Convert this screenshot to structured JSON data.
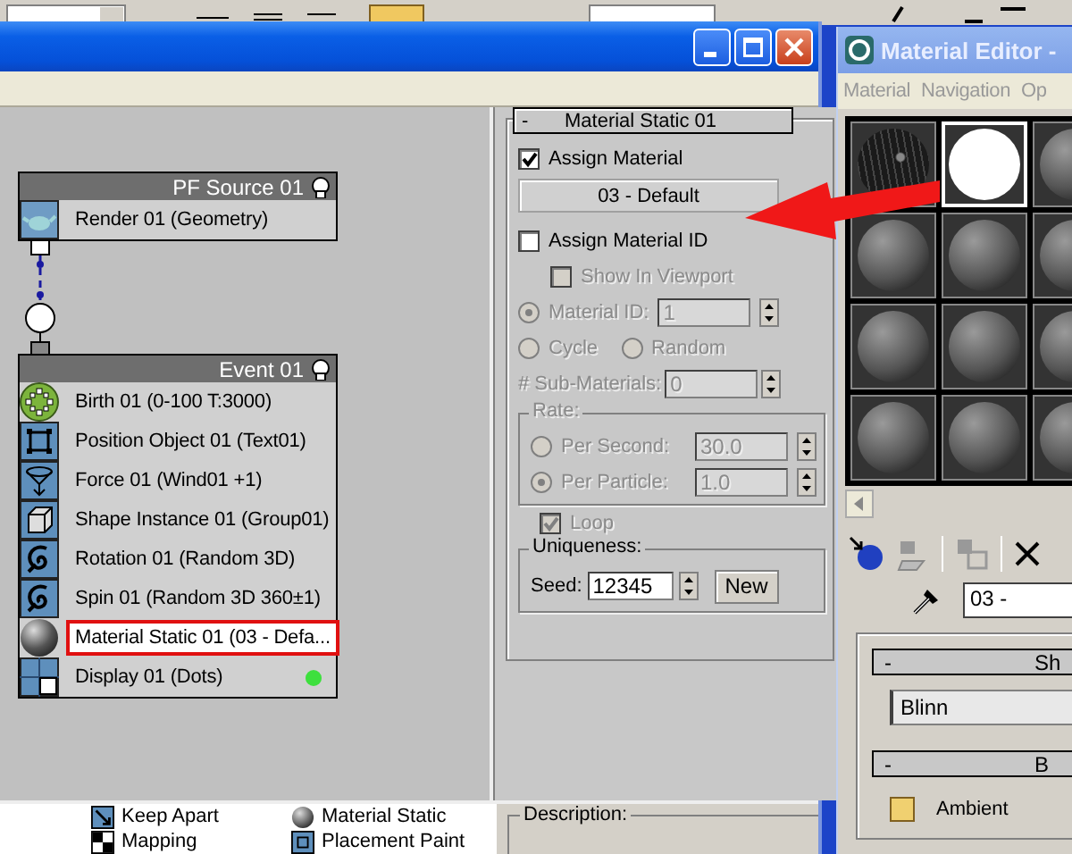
{
  "particle_view": {
    "nodes": [
      {
        "title": "PF Source 01",
        "operators": [
          {
            "kind": "render",
            "label": "Render 01 (Geometry)",
            "selected": false
          }
        ]
      },
      {
        "title": "Event 01",
        "operators": [
          {
            "kind": "birth",
            "label": "Birth 01 (0-100 T:3000)",
            "selected": false
          },
          {
            "kind": "position",
            "label": "Position Object 01 (Text01)",
            "selected": false
          },
          {
            "kind": "force",
            "label": "Force 01 (Wind01 +1)",
            "selected": false
          },
          {
            "kind": "shape",
            "label": "Shape Instance 01 (Group01)",
            "selected": false
          },
          {
            "kind": "rotation",
            "label": "Rotation 01 (Random 3D)",
            "selected": false
          },
          {
            "kind": "spin",
            "label": "Spin 01 (Random 3D 360±1)",
            "selected": false
          },
          {
            "kind": "material",
            "label": "Material Static 01 (03 - Defa...",
            "selected": true
          },
          {
            "kind": "display",
            "label": "Display 01 (Dots)",
            "selected": false
          }
        ]
      }
    ],
    "parameters": {
      "collapse": "-",
      "rollout_title": "Material Static 01",
      "assign_material": {
        "label": "Assign Material",
        "checked": true,
        "disabled": false
      },
      "material_button": "03 - Default",
      "assign_material_id": {
        "label": "Assign Material ID",
        "checked": false,
        "disabled": false
      },
      "show_in_viewport": {
        "label": "Show In Viewport",
        "checked": false,
        "disabled": true
      },
      "material_id": {
        "label": "Material ID:",
        "selected": true,
        "disabled": true,
        "value": "1"
      },
      "id_modes": [
        {
          "label": "Cycle",
          "selected": false,
          "disabled": true
        },
        {
          "label": "Random",
          "selected": false,
          "disabled": true
        }
      ],
      "sub_materials": {
        "label": "# Sub-Materials:",
        "value": "0",
        "disabled": true
      },
      "rate": {
        "title": "Rate:",
        "disabled": true,
        "options": [
          {
            "label": "Per Second:",
            "value": "30.0",
            "selected": false
          },
          {
            "label": "Per Particle:",
            "value": "1.0",
            "selected": true
          }
        ]
      },
      "loop": {
        "label": "Loop",
        "checked": true,
        "disabled": true
      },
      "uniqueness": {
        "title": "Uniqueness:",
        "seed_label": "Seed:",
        "seed": "12345",
        "new_button": "New"
      }
    },
    "depot": [
      {
        "kind": "keep_apart",
        "label": "Keep Apart"
      },
      {
        "kind": "material",
        "label": "Material Static"
      },
      {
        "kind": "mapping",
        "label": "Mapping"
      },
      {
        "kind": "placement",
        "label": "Placement Paint"
      }
    ],
    "description": {
      "title": "Description:"
    }
  },
  "material_editor": {
    "title": "Material Editor -",
    "menu": [
      "Material",
      "Navigation",
      "Op"
    ],
    "slots": [
      {
        "kind": "textured",
        "selected": false
      },
      {
        "kind": "white",
        "selected": true
      },
      {
        "kind": "sphere",
        "selected": false
      },
      {
        "kind": "sphere",
        "selected": false
      },
      {
        "kind": "sphere",
        "selected": false
      },
      {
        "kind": "sphere",
        "selected": false
      },
      {
        "kind": "sphere",
        "selected": false
      },
      {
        "kind": "sphere",
        "selected": false
      },
      {
        "kind": "sphere",
        "selected": false
      },
      {
        "kind": "sphere",
        "selected": false
      },
      {
        "kind": "sphere",
        "selected": false
      },
      {
        "kind": "sphere",
        "selected": false
      }
    ],
    "material_name": "03 -",
    "shader_rollout": {
      "collapse": "-",
      "title": "Sh",
      "shader": "Blinn"
    },
    "basic_rollout": {
      "collapse": "-",
      "title": "B",
      "ambient_label": "Ambient"
    }
  }
}
